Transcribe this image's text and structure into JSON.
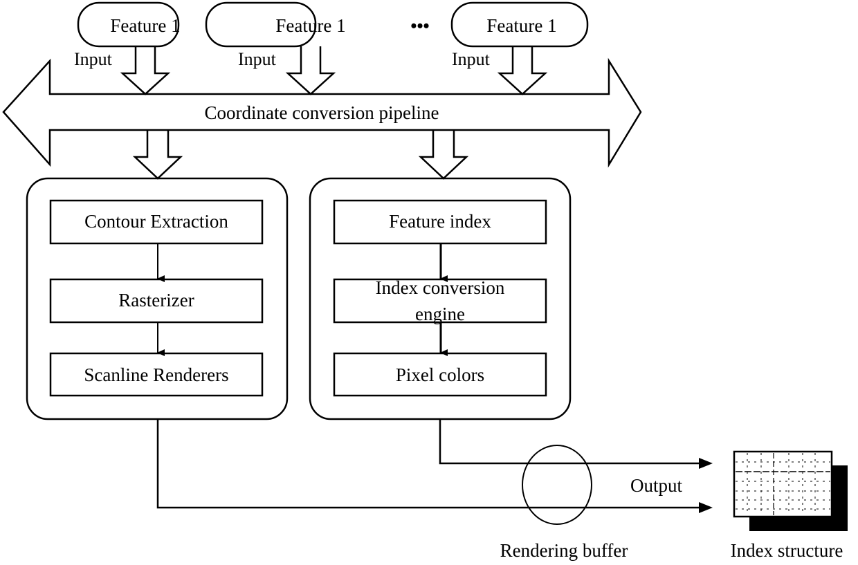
{
  "diagram": {
    "features": [
      {
        "label": "Feature 1",
        "input_label": "Input"
      },
      {
        "label": "Feature 1",
        "input_label": "Input"
      },
      {
        "label": "Feature 1",
        "input_label": "Input"
      }
    ],
    "ellipsis": "•••",
    "pipeline_label": "Coordinate conversion pipeline",
    "left_group": {
      "steps": [
        "Contour Extraction",
        "Rasterizer",
        "Scanline Renderers"
      ]
    },
    "right_group": {
      "steps": [
        "Feature index",
        "Index conversion engine",
        "Pixel colors"
      ],
      "step2_lines": [
        "Index conversion",
        "engine"
      ]
    },
    "output_label": "Output",
    "buffer_label": "Rendering buffer",
    "index_structure_label": "Index structure",
    "colors": {
      "stroke": "#000000",
      "background": "#ffffff"
    }
  }
}
